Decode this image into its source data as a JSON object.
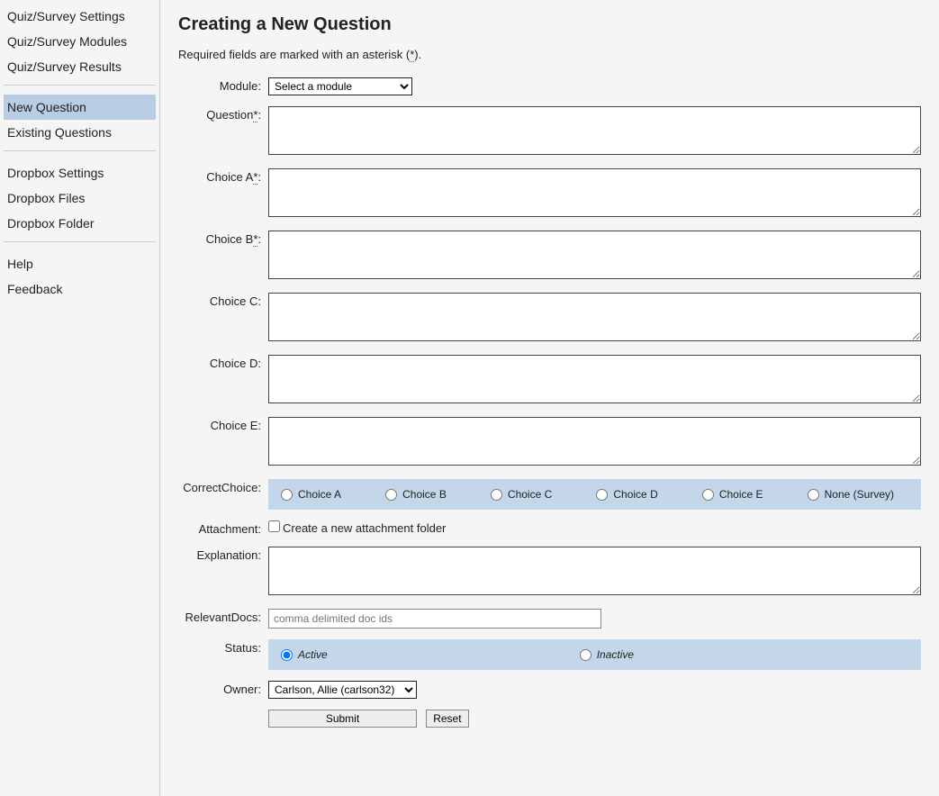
{
  "sidebar": {
    "group1": [
      {
        "label": "Quiz/Survey Settings"
      },
      {
        "label": "Quiz/Survey Modules"
      },
      {
        "label": "Quiz/Survey Results"
      }
    ],
    "group2": [
      {
        "label": "New Question",
        "active": true
      },
      {
        "label": "Existing Questions"
      }
    ],
    "group3": [
      {
        "label": "Dropbox Settings"
      },
      {
        "label": "Dropbox Files"
      },
      {
        "label": "Dropbox Folder"
      }
    ],
    "group4": [
      {
        "label": "Help"
      },
      {
        "label": "Feedback"
      }
    ]
  },
  "page": {
    "title": "Creating a New Question",
    "hint_prefix": "Required fields are marked with an asterisk (",
    "hint_asterisk": "*",
    "hint_suffix": ")."
  },
  "form": {
    "module": {
      "label": "Module:",
      "selected": "Select a module"
    },
    "question": {
      "label": "Question",
      "required": "*",
      "colon": ":"
    },
    "choiceA": {
      "label": "Choice A",
      "required": "*",
      "colon": ":"
    },
    "choiceB": {
      "label": "Choice B",
      "required": "*",
      "colon": ":"
    },
    "choiceC": {
      "label": "Choice C:"
    },
    "choiceD": {
      "label": "Choice D:"
    },
    "choiceE": {
      "label": "Choice E:"
    },
    "correctChoice": {
      "label": "CorrectChoice:",
      "options": [
        "Choice A",
        "Choice B",
        "Choice C",
        "Choice D",
        "Choice E",
        "None (Survey)"
      ]
    },
    "attachment": {
      "label": "Attachment:",
      "checkbox_label": "Create a new attachment folder"
    },
    "explanation": {
      "label": "Explanation:"
    },
    "relevantDocs": {
      "label": "RelevantDocs:",
      "placeholder": "comma delimited doc ids"
    },
    "status": {
      "label": "Status:",
      "active": "Active",
      "inactive": "Inactive"
    },
    "owner": {
      "label": "Owner:",
      "selected": "Carlson, Allie (carlson32)"
    },
    "submit": "Submit",
    "reset": "Reset"
  }
}
